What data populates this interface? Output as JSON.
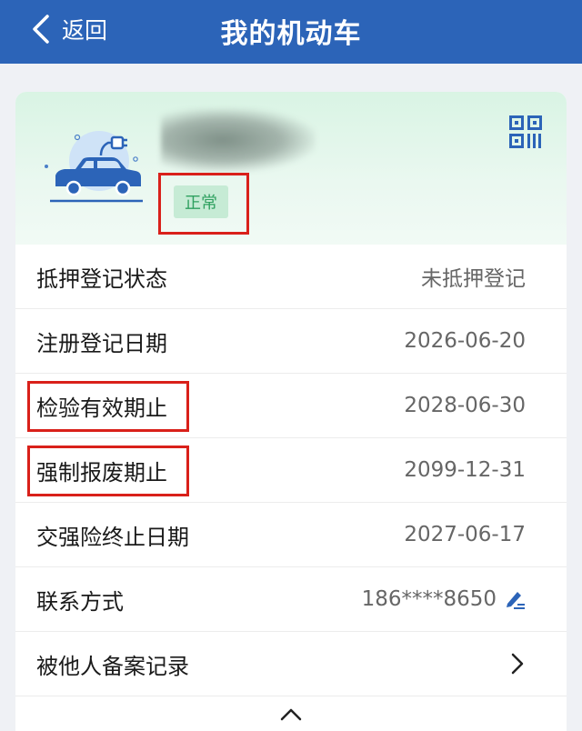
{
  "nav": {
    "back_label": "返回",
    "title": "我的机动车"
  },
  "vehicle": {
    "status": "正常"
  },
  "rows": [
    {
      "label": "抵押登记状态",
      "value": "未抵押登记"
    },
    {
      "label": "注册登记日期",
      "value": "2026-06-20"
    },
    {
      "label": "检验有效期止",
      "value": "2028-06-30"
    },
    {
      "label": "强制报废期止",
      "value": "2099-12-31"
    },
    {
      "label": "交强险终止日期",
      "value": "2027-06-17"
    },
    {
      "label": "联系方式",
      "value": "186****8650"
    },
    {
      "label": "被他人备案记录"
    }
  ],
  "colors": {
    "nav_bg": "#2c64b8",
    "status_green": "#2ea05f",
    "highlight_red": "#d9201a",
    "accent_blue": "#2c64b8"
  },
  "icons": [
    "back-arrow-icon",
    "electric-car-icon",
    "qr-code-icon",
    "edit-pen-icon",
    "chevron-right-icon",
    "chevron-up-icon"
  ]
}
